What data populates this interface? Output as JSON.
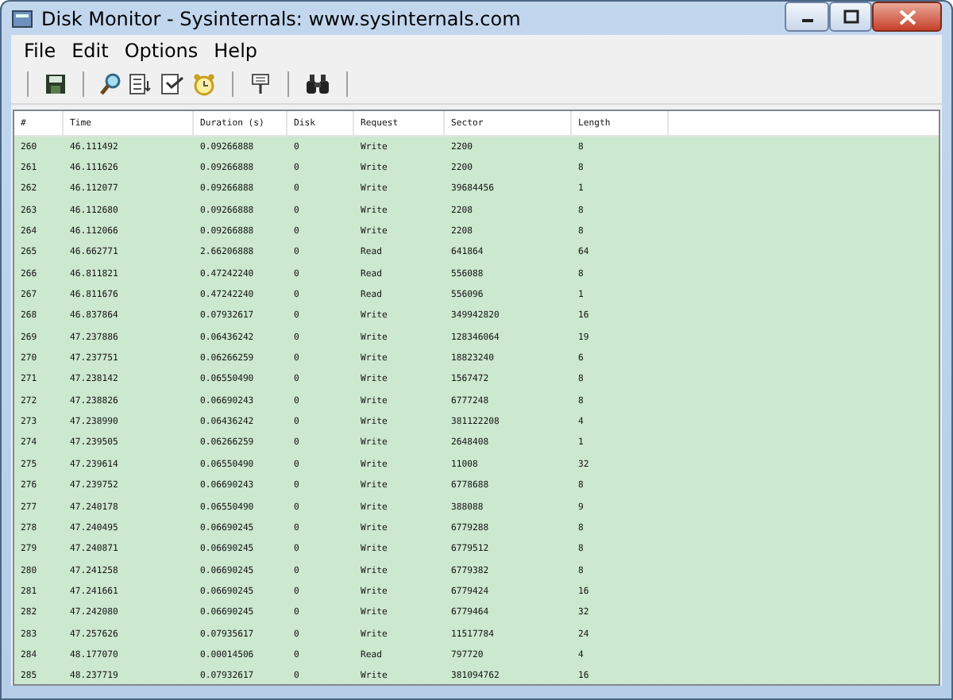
{
  "window": {
    "title": "Disk Monitor - Sysinternals: www.sysinternals.com"
  },
  "menu": [
    "File",
    "Edit",
    "Options",
    "Help"
  ],
  "table": {
    "columns": [
      "#",
      "Time",
      "Duration (s)",
      "Disk",
      "Request",
      "Sector",
      "Length"
    ],
    "rows": [
      [
        "260",
        "46.111492",
        "0.09266888",
        "0",
        "Write",
        "2200",
        "8"
      ],
      [
        "261",
        "46.111626",
        "0.09266888",
        "0",
        "Write",
        "2200",
        "8"
      ],
      [
        "262",
        "46.112077",
        "0.09266888",
        "0",
        "Write",
        "39684456",
        "1"
      ],
      [
        "263",
        "46.112680",
        "0.09266888",
        "0",
        "Write",
        "2208",
        "8"
      ],
      [
        "264",
        "46.112066",
        "0.09266888",
        "0",
        "Write",
        "2208",
        "8"
      ],
      [
        "265",
        "46.662771",
        "2.66206888",
        "0",
        "Read",
        "641864",
        "64"
      ],
      [
        "266",
        "46.811821",
        "0.47242240",
        "0",
        "Read",
        "556088",
        "8"
      ],
      [
        "267",
        "46.811676",
        "0.47242240",
        "0",
        "Read",
        "556096",
        "1"
      ],
      [
        "268",
        "46.837864",
        "0.07932617",
        "0",
        "Write",
        "349942820",
        "16"
      ],
      [
        "269",
        "47.237886",
        "0.06436242",
        "0",
        "Write",
        "128346064",
        "19"
      ],
      [
        "270",
        "47.237751",
        "0.06266259",
        "0",
        "Write",
        "18823240",
        "6"
      ],
      [
        "271",
        "47.238142",
        "0.06550490",
        "0",
        "Write",
        "1567472",
        "8"
      ],
      [
        "272",
        "47.238826",
        "0.06690243",
        "0",
        "Write",
        "6777248",
        "8"
      ],
      [
        "273",
        "47.238990",
        "0.06436242",
        "0",
        "Write",
        "381122208",
        "4"
      ],
      [
        "274",
        "47.239505",
        "0.06266259",
        "0",
        "Write",
        "2648408",
        "1"
      ],
      [
        "275",
        "47.239614",
        "0.06550490",
        "0",
        "Write",
        "11008",
        "32"
      ],
      [
        "276",
        "47.239752",
        "0.06690243",
        "0",
        "Write",
        "6778688",
        "8"
      ],
      [
        "277",
        "47.240178",
        "0.06550490",
        "0",
        "Write",
        "388088",
        "9"
      ],
      [
        "278",
        "47.240495",
        "0.06690245",
        "0",
        "Write",
        "6779288",
        "8"
      ],
      [
        "279",
        "47.240871",
        "0.06690245",
        "0",
        "Write",
        "6779512",
        "8"
      ],
      [
        "280",
        "47.241258",
        "0.06690245",
        "0",
        "Write",
        "6779382",
        "8"
      ],
      [
        "281",
        "47.241661",
        "0.06690245",
        "0",
        "Write",
        "6779424",
        "16"
      ],
      [
        "282",
        "47.242080",
        "0.06690245",
        "0",
        "Write",
        "6779464",
        "32"
      ],
      [
        "283",
        "47.257626",
        "0.07935617",
        "0",
        "Write",
        "11517784",
        "24"
      ],
      [
        "284",
        "48.177070",
        "0.00014506",
        "0",
        "Read",
        "797720",
        "4"
      ],
      [
        "285",
        "48.237719",
        "0.07932617",
        "0",
        "Write",
        "381094762",
        "16"
      ]
    ]
  }
}
